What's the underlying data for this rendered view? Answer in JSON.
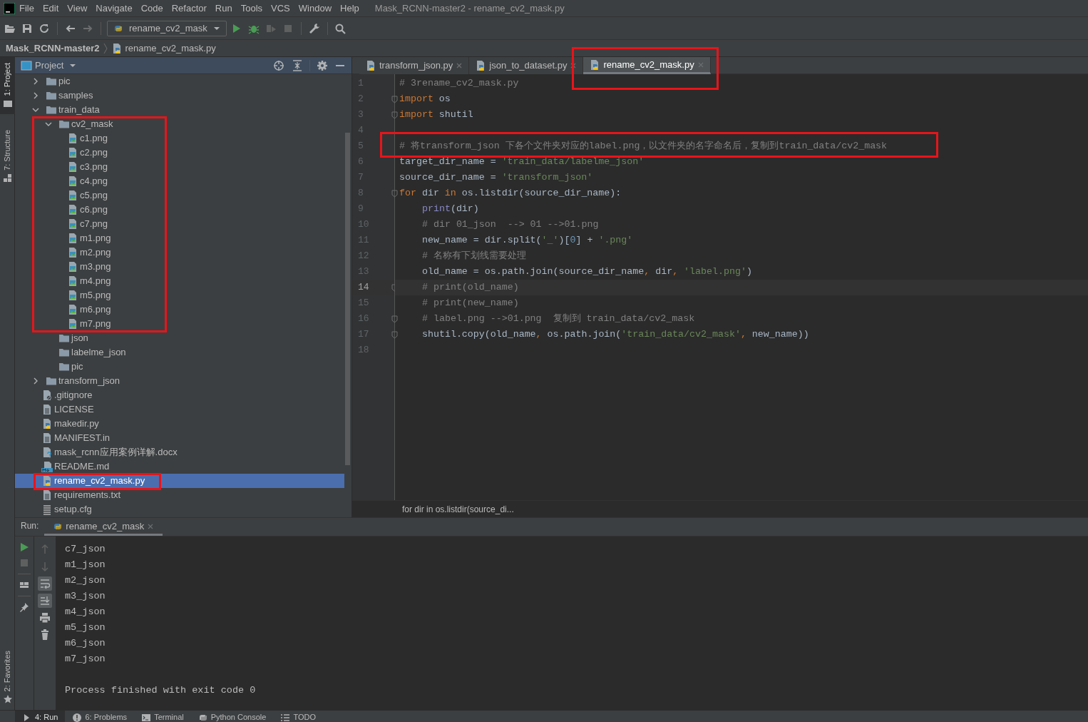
{
  "menu_bar": {
    "items": [
      "File",
      "Edit",
      "View",
      "Navigate",
      "Code",
      "Refactor",
      "Run",
      "Tools",
      "VCS",
      "Window",
      "Help"
    ],
    "title": "Mask_RCNN-master2 - rename_cv2_mask.py"
  },
  "toolbar": {
    "run_configuration": "rename_cv2_mask"
  },
  "breadcrumb": [
    "Mask_RCNN-master2",
    "rename_cv2_mask.py"
  ],
  "left_stripe": [
    {
      "label": "1: Project",
      "selected": true
    },
    {
      "label": "7: Structure",
      "selected": false
    },
    {
      "label": "2: Favorites",
      "selected": false
    }
  ],
  "project_panel": {
    "title": "Project",
    "tree": [
      {
        "label": "pic",
        "kind": "folder",
        "expanded": false,
        "selected": false
      },
      {
        "label": "samples",
        "kind": "folder",
        "expanded": false,
        "selected": false
      },
      {
        "label": "train_data",
        "kind": "folder",
        "expanded": true,
        "selected": false,
        "children": [
          {
            "label": "cv2_mask",
            "kind": "folder",
            "expanded": true,
            "selected": false,
            "children": [
              {
                "label": "c1.png",
                "kind": "image",
                "selected": false
              },
              {
                "label": "c2.png",
                "kind": "image",
                "selected": false
              },
              {
                "label": "c3.png",
                "kind": "image",
                "selected": false
              },
              {
                "label": "c4.png",
                "kind": "image",
                "selected": false
              },
              {
                "label": "c5.png",
                "kind": "image",
                "selected": false
              },
              {
                "label": "c6.png",
                "kind": "image",
                "selected": false
              },
              {
                "label": "c7.png",
                "kind": "image",
                "selected": false
              },
              {
                "label": "m1.png",
                "kind": "image",
                "selected": false
              },
              {
                "label": "m2.png",
                "kind": "image",
                "selected": false
              },
              {
                "label": "m3.png",
                "kind": "image",
                "selected": false
              },
              {
                "label": "m4.png",
                "kind": "image",
                "selected": false
              },
              {
                "label": "m5.png",
                "kind": "image",
                "selected": false
              },
              {
                "label": "m6.png",
                "kind": "image",
                "selected": false
              },
              {
                "label": "m7.png",
                "kind": "image",
                "selected": false
              }
            ]
          },
          {
            "label": "json",
            "kind": "empty-folder",
            "selected": false
          },
          {
            "label": "labelme_json",
            "kind": "empty-folder",
            "selected": false
          },
          {
            "label": "pic",
            "kind": "empty-folder",
            "selected": false
          }
        ]
      },
      {
        "label": "transform_json",
        "kind": "folder",
        "expanded": false,
        "selected": false
      },
      {
        "label": ".gitignore",
        "kind": "ignore",
        "selected": false
      },
      {
        "label": "LICENSE",
        "kind": "text",
        "selected": false
      },
      {
        "label": "makedir.py",
        "kind": "python",
        "selected": false
      },
      {
        "label": "MANIFEST.in",
        "kind": "text",
        "selected": false
      },
      {
        "label": "mask_rcnn应用案例详解.docx",
        "kind": "unknown",
        "selected": false
      },
      {
        "label": "README.md",
        "kind": "markdown",
        "selected": false
      },
      {
        "label": "rename_cv2_mask.py",
        "kind": "python",
        "selected": true
      },
      {
        "label": "requirements.txt",
        "kind": "text",
        "selected": false
      },
      {
        "label": "setup.cfg",
        "kind": "config",
        "selected": false
      }
    ]
  },
  "editor": {
    "tabs": [
      {
        "label": "transform_json.py",
        "selected": false
      },
      {
        "label": "json_to_dataset.py",
        "selected": false
      },
      {
        "label": "rename_cv2_mask.py",
        "selected": true
      }
    ],
    "lines": [
      {
        "number": "1",
        "current": false,
        "fold": false,
        "tokens": [
          {
            "text": "# 3rename_cv2_mask.py",
            "kind": "comment"
          }
        ]
      },
      {
        "number": "2",
        "current": false,
        "fold": true,
        "tokens": [
          {
            "text": "import",
            "kind": "keyword"
          },
          {
            "text": " os",
            "kind": "plain"
          }
        ]
      },
      {
        "number": "3",
        "current": false,
        "fold": true,
        "tokens": [
          {
            "text": "import",
            "kind": "keyword"
          },
          {
            "text": " shutil",
            "kind": "plain"
          }
        ]
      },
      {
        "number": "4",
        "current": false,
        "fold": false
      },
      {
        "number": "5",
        "current": false,
        "fold": false,
        "tokens": [
          {
            "text": "# 将transform_json 下各个文件夹对应的label.png，以文件夹的名字命名后，复制到train_data/cv2_mask",
            "kind": "comment"
          }
        ]
      },
      {
        "number": "6",
        "current": false,
        "fold": false,
        "tokens": [
          {
            "text": "target_dir_name = ",
            "kind": "plain"
          },
          {
            "text": "'train_data/labelme_json'",
            "kind": "string"
          }
        ]
      },
      {
        "number": "7",
        "current": false,
        "fold": false,
        "tokens": [
          {
            "text": "source_dir_name = ",
            "kind": "plain"
          },
          {
            "text": "'transform_json'",
            "kind": "string"
          }
        ]
      },
      {
        "number": "8",
        "current": false,
        "fold": true,
        "tokens": [
          {
            "text": "for",
            "kind": "keyword"
          },
          {
            "text": " dir ",
            "kind": "plain"
          },
          {
            "text": "in",
            "kind": "keyword"
          },
          {
            "text": " os.listdir(source_dir_name):",
            "kind": "plain"
          }
        ]
      },
      {
        "number": "9",
        "current": false,
        "fold": false,
        "indented": true,
        "tokens": [
          {
            "text": "print",
            "kind": "builtin"
          },
          {
            "text": "(dir)",
            "kind": "plain"
          }
        ]
      },
      {
        "number": "10",
        "current": false,
        "fold": false,
        "indented": true,
        "tokens": [
          {
            "text": "# dir 01_json  --> 01 -->01.png",
            "kind": "comment"
          }
        ]
      },
      {
        "number": "11",
        "current": false,
        "fold": false,
        "indented": true,
        "tokens": [
          {
            "text": "new_name = dir.split(",
            "kind": "plain"
          },
          {
            "text": "'_'",
            "kind": "string"
          },
          {
            "text": ")[",
            "kind": "plain"
          },
          {
            "text": "0",
            "kind": "number"
          },
          {
            "text": "] + ",
            "kind": "plain"
          },
          {
            "text": "'.png'",
            "kind": "string"
          }
        ]
      },
      {
        "number": "12",
        "current": false,
        "fold": false,
        "indented": true,
        "tokens": [
          {
            "text": "# 名称有下划线需要处理",
            "kind": "comment"
          }
        ]
      },
      {
        "number": "13",
        "current": false,
        "fold": false,
        "indented": true,
        "tokens": [
          {
            "text": "old_name = os.path.join(source_dir_name",
            "kind": "plain"
          },
          {
            "text": ", ",
            "kind": "keyword"
          },
          {
            "text": "dir",
            "kind": "plain"
          },
          {
            "text": ", ",
            "kind": "keyword"
          },
          {
            "text": "'label.png'",
            "kind": "string"
          },
          {
            "text": ")",
            "kind": "plain"
          }
        ]
      },
      {
        "number": "14",
        "current": true,
        "fold": true,
        "indented": true,
        "tokens": [
          {
            "text": "# print(old_name)",
            "kind": "comment"
          }
        ]
      },
      {
        "number": "15",
        "current": false,
        "fold": false,
        "indented": true,
        "tokens": [
          {
            "text": "# print(new_name)",
            "kind": "comment"
          }
        ]
      },
      {
        "number": "16",
        "current": false,
        "fold": true,
        "indented": true,
        "tokens": [
          {
            "text": "# label.png -->01.png  复制到 train_data/cv2_mask",
            "kind": "comment"
          }
        ]
      },
      {
        "number": "17",
        "current": false,
        "fold": true,
        "indented": true,
        "tokens": [
          {
            "text": "shutil.copy(old_name",
            "kind": "plain"
          },
          {
            "text": ", ",
            "kind": "keyword"
          },
          {
            "text": "os.path.join(",
            "kind": "plain"
          },
          {
            "text": "'train_data/cv2_mask'",
            "kind": "string"
          },
          {
            "text": ", ",
            "kind": "keyword"
          },
          {
            "text": "new_name))",
            "kind": "plain"
          }
        ]
      },
      {
        "number": "18",
        "current": false,
        "fold": false
      }
    ],
    "breadcrumb_hint": "for dir in os.listdir(source_di..."
  },
  "run_panel": {
    "label": "Run:",
    "tab": "rename_cv2_mask",
    "output": [
      "c7_json",
      "m1_json",
      "m2_json",
      "m3_json",
      "m4_json",
      "m5_json",
      "m6_json",
      "m7_json"
    ],
    "exit_message": "Process finished with exit code 0"
  },
  "bottom_tabs": [
    {
      "label": "4: Run",
      "selected": true,
      "kind": "run"
    },
    {
      "label": "6: Problems",
      "selected": false,
      "kind": "problems"
    },
    {
      "label": "Terminal",
      "selected": false,
      "kind": "terminal"
    },
    {
      "label": "Python Console",
      "selected": false,
      "kind": "python"
    },
    {
      "label": "TODO",
      "selected": false,
      "kind": "todo"
    }
  ]
}
